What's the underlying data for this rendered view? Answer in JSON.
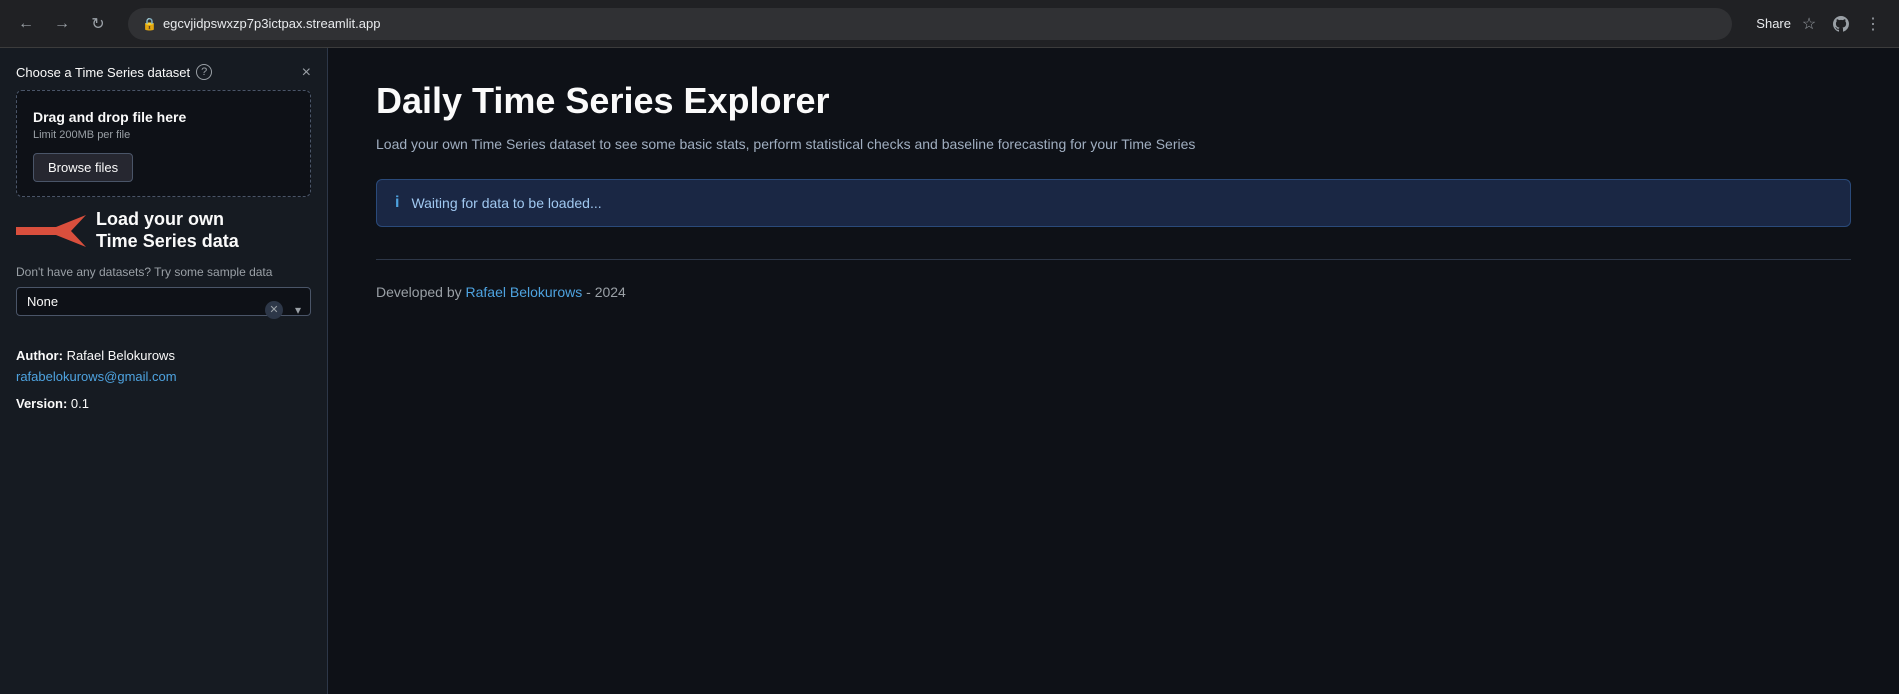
{
  "browser": {
    "url": "egcvjidpswxzp7p3ictpax.streamlit.app",
    "back_label": "←",
    "forward_label": "→",
    "reload_label": "↻",
    "share_label": "Share",
    "right_actions": [
      "☆",
      "⊕",
      "⋮"
    ]
  },
  "sidebar": {
    "close_label": "×",
    "dataset_section_label": "Choose a Time Series dataset",
    "help_icon_label": "?",
    "upload": {
      "title": "Drag and drop file here",
      "subtitle": "Limit 200MB per file",
      "browse_button_label": "Browse files"
    },
    "annotation": {
      "text_line1": "Load your own",
      "text_line2": "Time Series data"
    },
    "sample_data_label": "Don't have any datasets? Try some sample data",
    "sample_select_value": "None",
    "sample_select_placeholder": "None",
    "author_label": "Author:",
    "author_name": "Rafael Belokurows",
    "author_email": "rafabelokurows@gmail.com",
    "version_label": "Version:",
    "version_value": "0.1"
  },
  "main": {
    "title": "Daily Time Series Explorer",
    "description": "Load your own Time Series dataset to see some basic stats, perform statistical checks and baseline forecasting for your Time Series",
    "info_banner_text": "Waiting for data to be loaded...",
    "footer_text_pre": "Developed by ",
    "footer_link_text": "Rafael Belokurows",
    "footer_text_post": " - 2024"
  }
}
